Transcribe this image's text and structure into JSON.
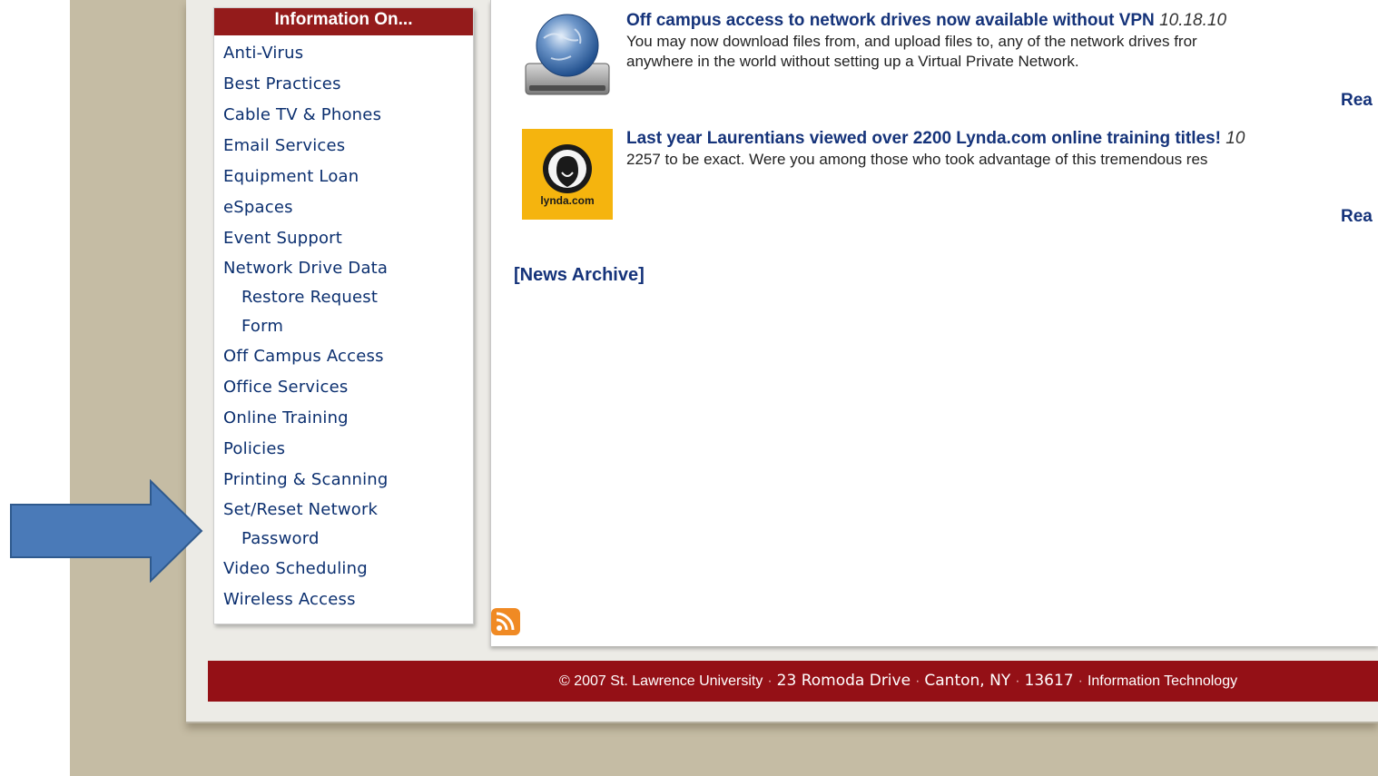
{
  "sidebar": {
    "header": "Information On...",
    "items": [
      {
        "label": "Anti-Virus"
      },
      {
        "label": "Best Practices"
      },
      {
        "label": "Cable TV & Phones"
      },
      {
        "label": "Email Services"
      },
      {
        "label": "Equipment Loan"
      },
      {
        "label": "eSpaces"
      },
      {
        "label": "Event Support"
      },
      {
        "label_line1": "Network Drive Data",
        "label_line2": "Restore Request",
        "label_line3": "Form"
      },
      {
        "label": "Off Campus Access"
      },
      {
        "label": "Office Services"
      },
      {
        "label": "Online Training"
      },
      {
        "label": "Policies"
      },
      {
        "label": "Printing & Scanning"
      },
      {
        "label_line1": "Set/Reset Network",
        "label_line2": "Password"
      },
      {
        "label": "Video Scheduling"
      },
      {
        "label": "Wireless Access"
      }
    ]
  },
  "news": [
    {
      "title": "Off campus access to network drives now available without VPN",
      "date": "10.18.10",
      "body_line1": "You may now download files from, and upload files to, any of the network drives fror",
      "body_line2": "anywhere in the world without setting up a Virtual Private Network.",
      "read_more": "Rea",
      "icon": "network-drive-globe-icon"
    },
    {
      "title": "Last year Laurentians viewed over 2200 Lynda.com online training titles!",
      "date": "10",
      "body_line1": "2257 to be exact. Were you among those who took advantage of this tremendous res",
      "read_more": "Rea",
      "icon": "lynda-com-logo",
      "logo_text": "lynda.com"
    }
  ],
  "news_archive": "[News Archive]",
  "rss_icon": "rss-feed-icon",
  "footer": {
    "copyright": "© 2007 St. Lawrence University",
    "address": "23 Romoda Drive",
    "city": "Canton, NY",
    "zip": "13617",
    "dept": "Information Technology"
  },
  "annotation": {
    "icon": "arrow-right-icon",
    "color": "#4a7ab8"
  },
  "colors": {
    "header_red": "#941b1b",
    "footer_red": "#941016",
    "link_blue": "#0b2f6f",
    "background_tan": "#c5bca4"
  }
}
